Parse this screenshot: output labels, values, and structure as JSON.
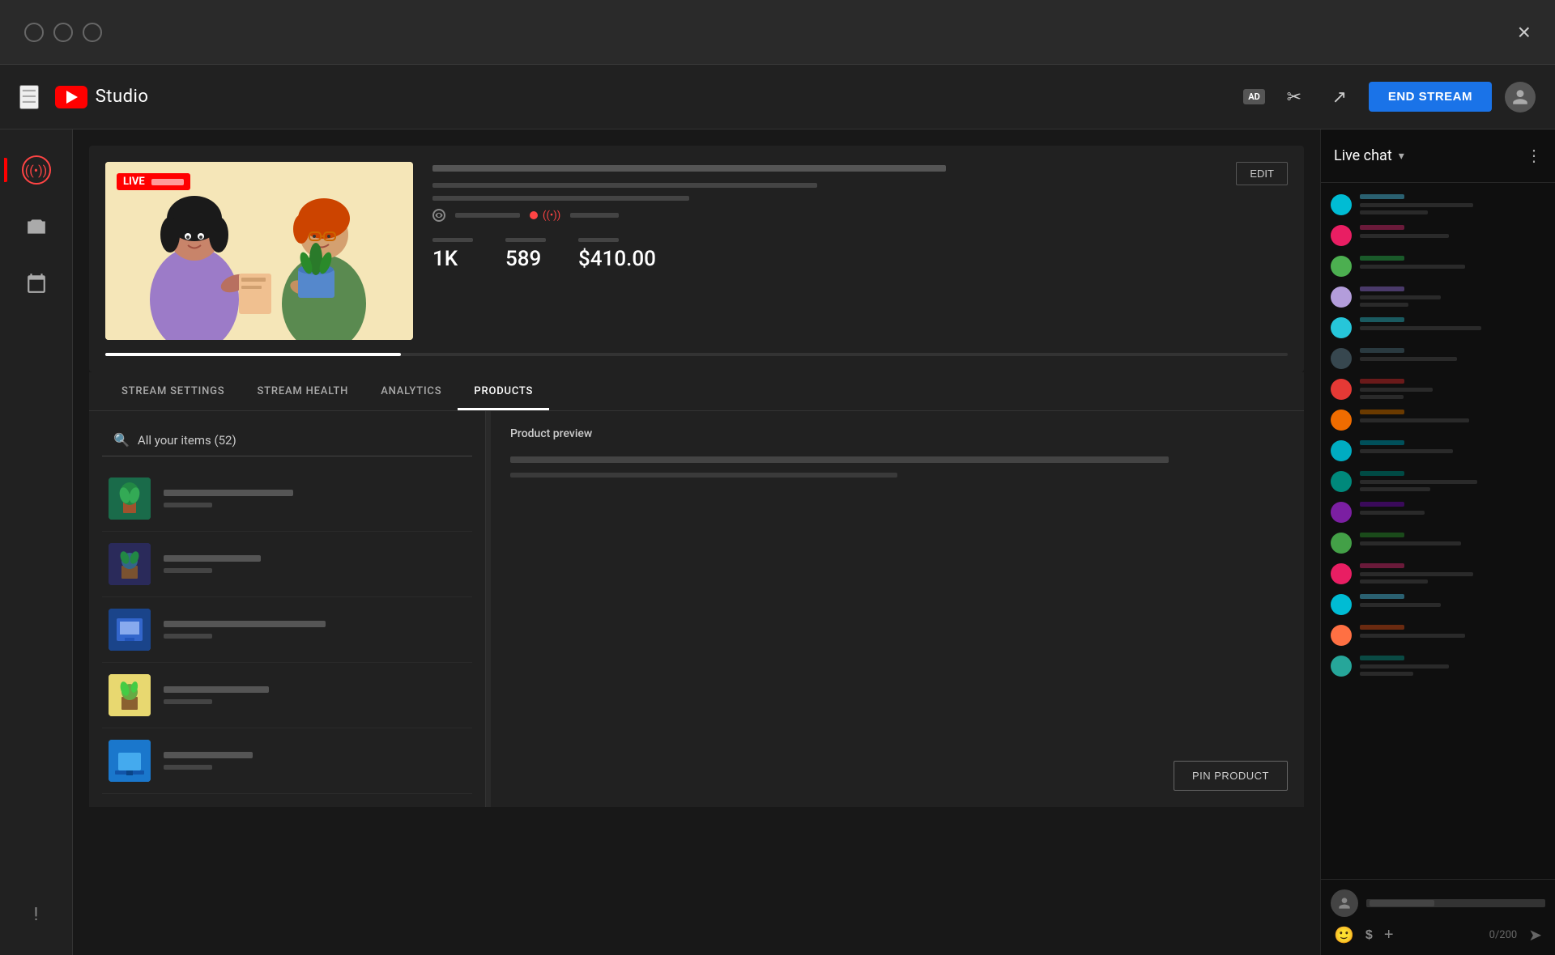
{
  "window": {
    "close_label": "×"
  },
  "topbar": {
    "studio_label": "Studio",
    "ad_badge": "AD",
    "end_stream_label": "END STREAM"
  },
  "sidebar": {
    "items": [
      {
        "id": "live",
        "label": "Live"
      },
      {
        "id": "camera",
        "label": "Camera"
      },
      {
        "id": "calendar",
        "label": "Calendar"
      }
    ],
    "feedback_label": "Feedback"
  },
  "stream": {
    "live_badge": "LIVE",
    "edit_btn": "EDIT",
    "stats": {
      "viewers": "1K",
      "likes": "589",
      "revenue": "$410.00"
    },
    "progress_percent": 25
  },
  "tabs": [
    {
      "id": "stream-settings",
      "label": "STREAM SETTINGS",
      "active": false
    },
    {
      "id": "stream-health",
      "label": "STREAM HEALTH",
      "active": false
    },
    {
      "id": "analytics",
      "label": "ANALYTICS",
      "active": false
    },
    {
      "id": "products",
      "label": "PRODUCTS",
      "active": true
    }
  ],
  "products": {
    "search_text": "All your items (52)",
    "preview_title": "Product preview",
    "pin_btn": "PIN PRODUCT",
    "items": [
      {
        "id": 1,
        "thumb_class": "product-thumb-1"
      },
      {
        "id": 2,
        "thumb_class": "product-thumb-2"
      },
      {
        "id": 3,
        "thumb_class": "product-thumb-3"
      },
      {
        "id": 4,
        "thumb_class": "product-thumb-4"
      },
      {
        "id": 5,
        "thumb_class": "product-thumb-5"
      }
    ]
  },
  "chat": {
    "title": "Live chat",
    "dropdown_arrow": "▾",
    "more_icon": "⋮",
    "messages": [
      {
        "avatar_color": "#00bcd4",
        "name_bar_color": "#2a6070",
        "text_width": "140px"
      },
      {
        "avatar_color": "#e91e63",
        "name_bar_color": "#6a1a3a",
        "text_width": "110px"
      },
      {
        "avatar_color": "#4caf50",
        "name_bar_color": "#1a5a2a",
        "text_width": "130px"
      },
      {
        "avatar_color": "#b39ddb",
        "name_bar_color": "#4a3a6a",
        "text_width": "100px"
      },
      {
        "avatar_color": "#26c6da",
        "name_bar_color": "#1a5a60",
        "text_width": "150px"
      },
      {
        "avatar_color": "#37474f",
        "name_bar_color": "#2a3a40",
        "text_width": "120px"
      },
      {
        "avatar_color": "#e53935",
        "name_bar_color": "#6a1a1a",
        "text_width": "90px"
      },
      {
        "avatar_color": "#ef6c00",
        "name_bar_color": "#6a3a00",
        "text_width": "135px"
      },
      {
        "avatar_color": "#00acc1",
        "name_bar_color": "#00505a",
        "text_width": "115px"
      },
      {
        "avatar_color": "#00897b",
        "name_bar_color": "#004a44",
        "text_width": "145px"
      },
      {
        "avatar_color": "#7b1fa2",
        "name_bar_color": "#3a0a5a",
        "text_width": "80px"
      },
      {
        "avatar_color": "#43a047",
        "name_bar_color": "#1a4a1a",
        "text_width": "125px"
      },
      {
        "avatar_color": "#e91e63",
        "name_bar_color": "#6a1a3a",
        "text_width": "140px"
      },
      {
        "avatar_color": "#00bcd4",
        "name_bar_color": "#2a6070",
        "text_width": "100px"
      },
      {
        "avatar_color": "#ff7043",
        "name_bar_color": "#6a2a10",
        "text_width": "130px"
      },
      {
        "avatar_color": "#26a69a",
        "name_bar_color": "#0a4a44",
        "text_width": "110px"
      }
    ],
    "input_placeholder": "",
    "counter": "0/200"
  }
}
